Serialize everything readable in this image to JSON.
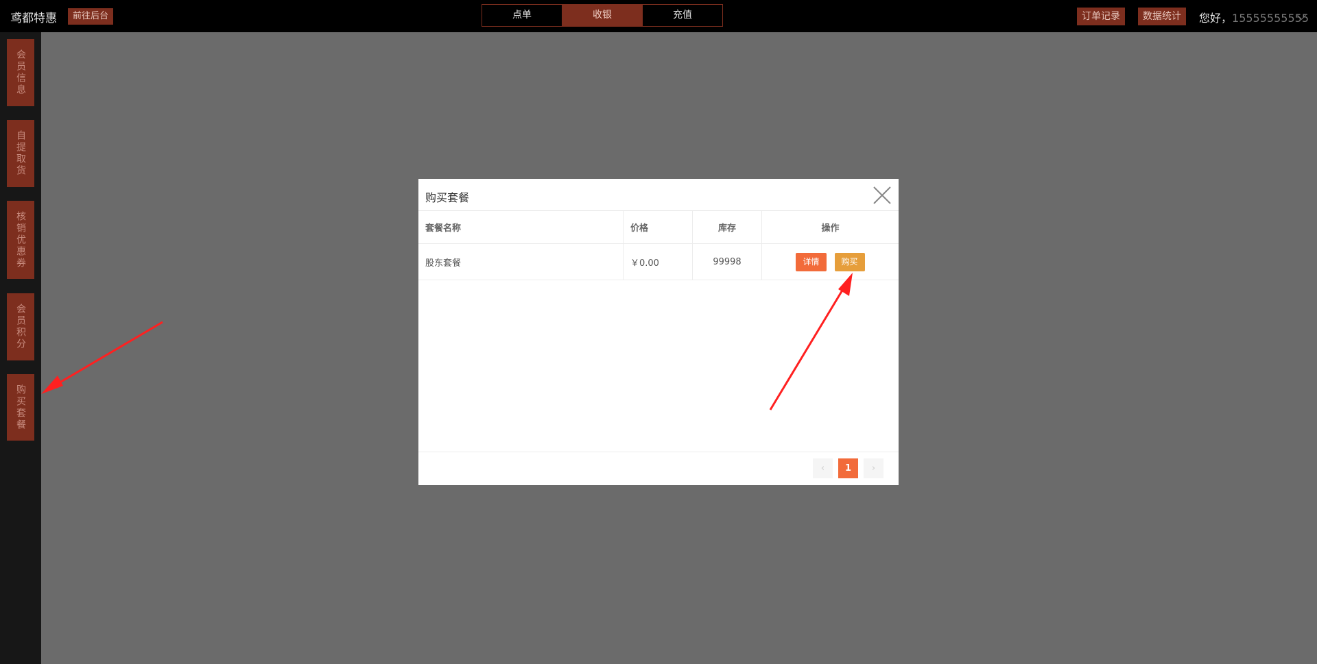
{
  "header": {
    "brand": "鸢都特惠",
    "to_admin": "前往后台",
    "tabs": [
      {
        "label": "点单",
        "active": false
      },
      {
        "label": "收银",
        "active": true
      },
      {
        "label": "充值",
        "active": false
      }
    ],
    "order_records": "订单记录",
    "data_stats": "数据统计",
    "greeting": "您好，",
    "phone": "15555555555"
  },
  "sidebar": {
    "items": [
      {
        "label": "会员信息"
      },
      {
        "label": "自提取货"
      },
      {
        "label": "核销优惠券"
      },
      {
        "label": "会员积分"
      },
      {
        "label": "购买套餐"
      }
    ]
  },
  "modal": {
    "title": "购买套餐",
    "columns": [
      "套餐名称",
      "价格",
      "库存",
      "操作"
    ],
    "rows": [
      {
        "name": "股东套餐",
        "price": "￥0.00",
        "stock": "99998",
        "detail_label": "详情",
        "buy_label": "购买"
      }
    ],
    "pager": {
      "prev": "‹",
      "current": "1",
      "next": "›"
    }
  },
  "colors": {
    "accent": "#7d2e1e",
    "detail": "#f26b3a",
    "buy": "#e69e3b",
    "overlay": "#6b6b6b"
  }
}
